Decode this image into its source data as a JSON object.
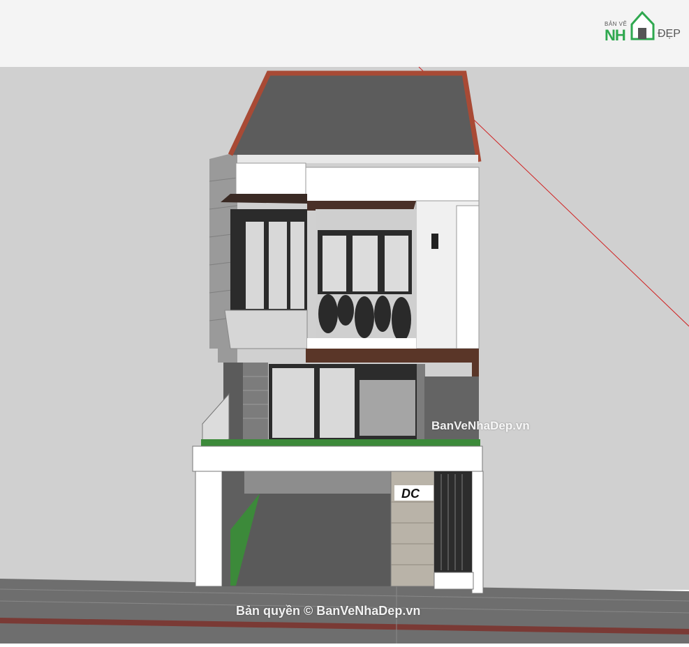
{
  "logo": {
    "small_text": "BẢN VẼ",
    "name_part": "NH",
    "suffix": "ĐẸP"
  },
  "watermarks": {
    "middle": "BanVeNhaDep.vn",
    "bottom": "Bản quyền © BanVeNhaDep.vn"
  },
  "house_sign": "DC",
  "colors": {
    "sky": "#f3f3f3",
    "ground": "#cfcfcf",
    "road": "#6b6b6b",
    "roof": "#5e5e5e",
    "roof_trim": "#a84a35",
    "wall_white": "#ffffff",
    "brick": "#8a8a8a",
    "wood": "#5a3628",
    "grass": "#3c8a3a",
    "logo_green": "#2fa84f"
  }
}
